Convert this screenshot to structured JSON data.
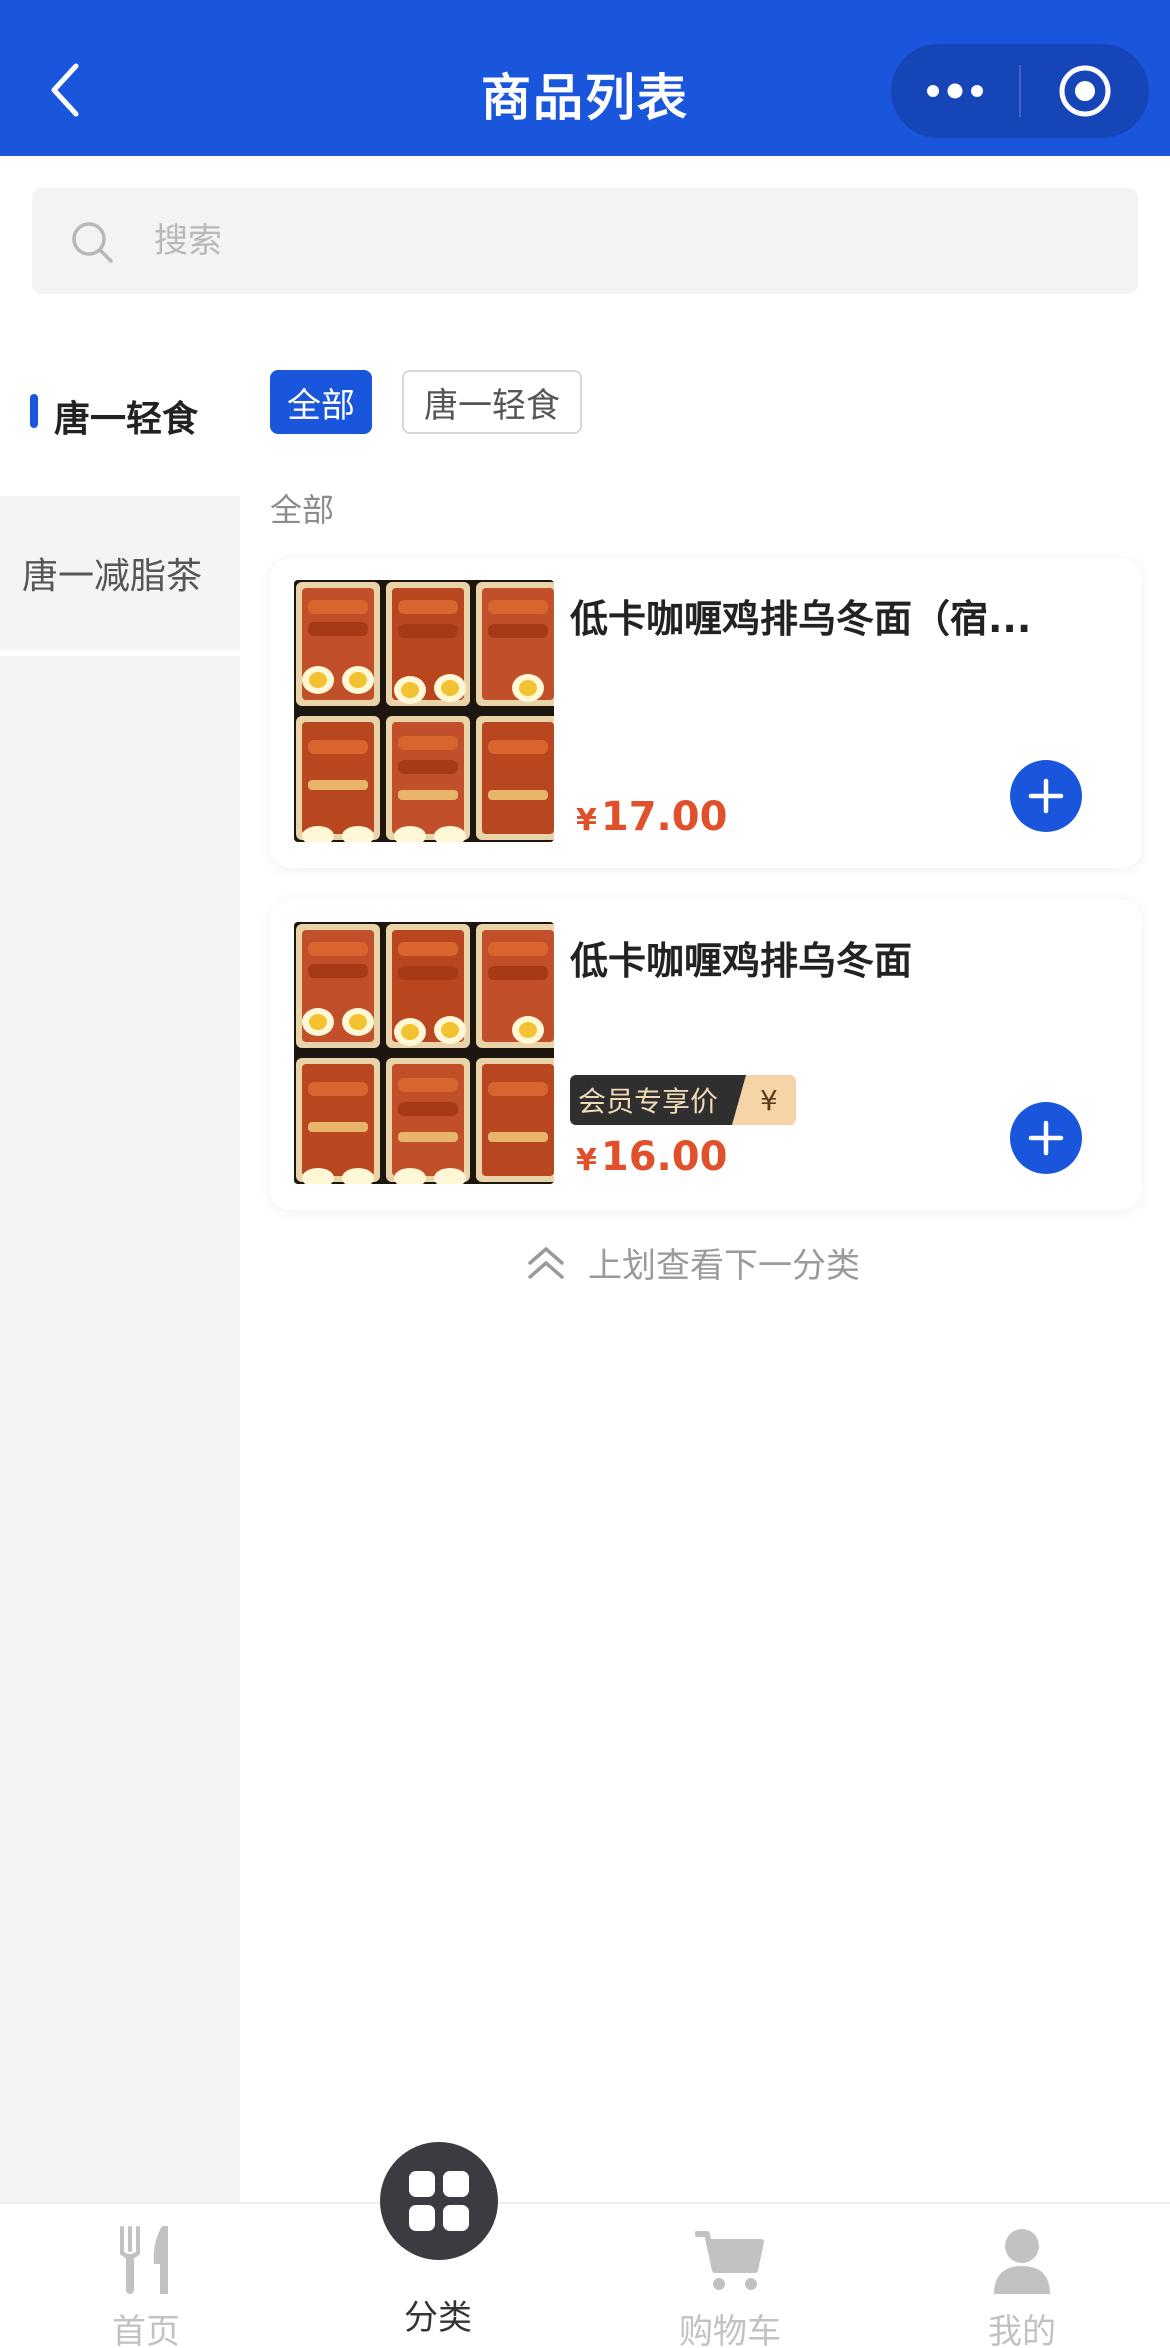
{
  "header": {
    "title": "商品列表"
  },
  "search": {
    "placeholder": "搜索"
  },
  "sidebar": {
    "items": [
      {
        "label": "唐一轻食",
        "active": true
      },
      {
        "label": "唐一减脂茶",
        "active": false
      }
    ]
  },
  "filter_chips": [
    {
      "label": "全部",
      "selected": true
    },
    {
      "label": "唐一轻食",
      "selected": false
    }
  ],
  "section": {
    "label": "全部"
  },
  "products": [
    {
      "name": "低卡咖喱鸡排乌冬面（宿...",
      "currency": "¥",
      "price": "17.00"
    },
    {
      "name": "低卡咖喱鸡排乌冬面",
      "member_tag": "会员专享价",
      "member_price_symbol": "¥",
      "currency": "¥",
      "price": "16.00"
    }
  ],
  "swipe_hint": "上划查看下一分类",
  "tabbar": {
    "items": [
      {
        "label": "首页",
        "icon": "fork-knife-icon",
        "active": false
      },
      {
        "label": "分类",
        "icon": "grid-icon",
        "active": true
      },
      {
        "label": "购物车",
        "icon": "cart-icon",
        "active": false
      },
      {
        "label": "我的",
        "icon": "user-icon",
        "active": false
      }
    ]
  },
  "colors": {
    "brand": "#1a56db",
    "price": "#e0512b",
    "sidebar_bg": "#f4f4f4"
  }
}
